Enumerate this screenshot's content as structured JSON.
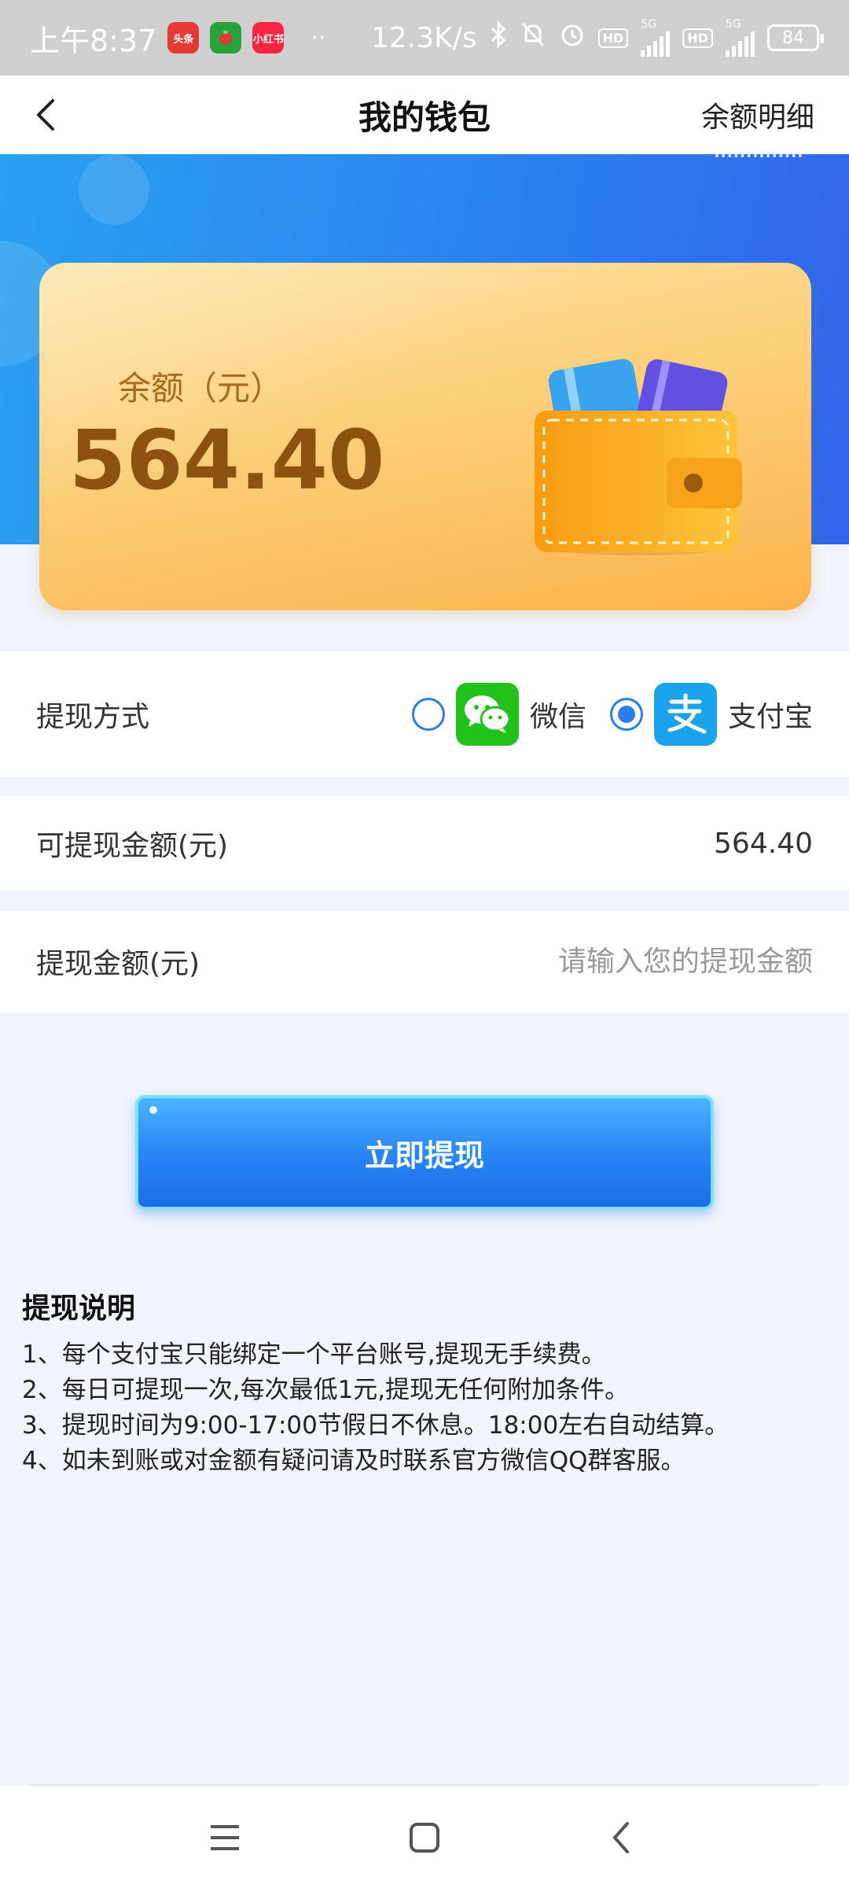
{
  "status_bar": {
    "time": "上午8:37",
    "app_badges": [
      {
        "label": "头条",
        "color": "#e53935"
      },
      {
        "label": "",
        "color": "#27a33a"
      },
      {
        "label": "小红书",
        "color": "#ff2442"
      }
    ],
    "dots": "··",
    "network_speed": "12.3K/s",
    "network_type_1": "5G",
    "network_type_2": "5G",
    "hd_label": "HD",
    "battery": "84"
  },
  "header": {
    "title": "我的钱包",
    "detail_link": "余额明细"
  },
  "balance_card": {
    "label": "余额（元）",
    "value": "564.40"
  },
  "withdraw_method": {
    "label": "提现方式",
    "options": [
      {
        "label": "微信",
        "selected": false,
        "icon": "wechat-icon",
        "color": "#22c11b"
      },
      {
        "label": "支付宝",
        "selected": true,
        "icon": "alipay-icon",
        "color": "#1aa3e8"
      }
    ]
  },
  "available": {
    "label": "可提现金额(元)",
    "value": "564.40"
  },
  "amount": {
    "label": "提现金额(元)",
    "placeholder": "请输入您的提现金额",
    "value": ""
  },
  "withdraw_button": {
    "label": "立即提现"
  },
  "instructions": {
    "title": "提现说明",
    "lines": [
      "1、每个支付宝只能绑定一个平台账号,提现无手续费。",
      "2、每日可提现一次,每次最低1元,提现无任何附加条件。",
      "3、提现时间为9:00-17:00节假日不休息。18:00左右自动结算。",
      "4、如未到账或对金额有疑问请及时联系官方微信QQ群客服。"
    ]
  },
  "colors": {
    "accent": "#2b7de9",
    "banner_blue": "#2a86ee",
    "card_gold": "#fccf7a",
    "balance_text": "#8e5210"
  }
}
